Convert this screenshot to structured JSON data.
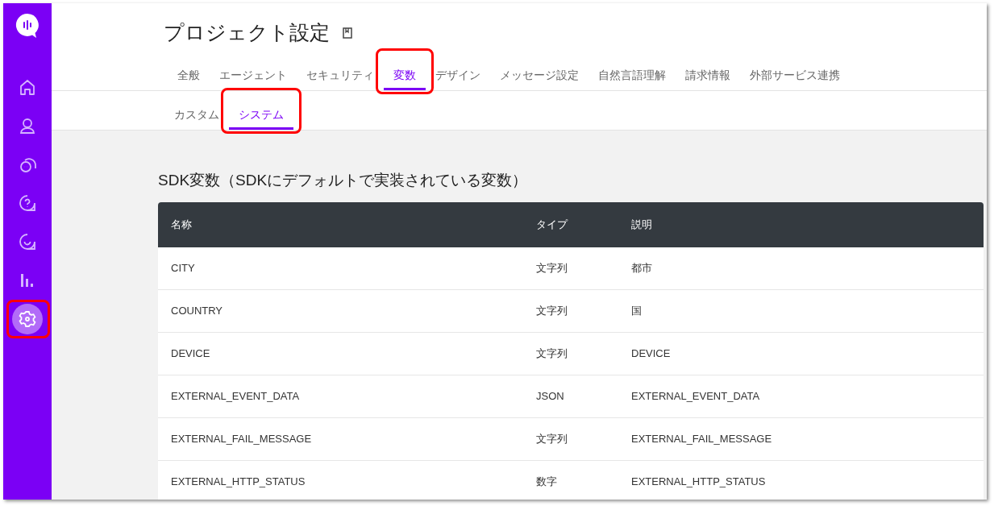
{
  "sidebar": {
    "items": [
      {
        "kind": "home",
        "selected": false,
        "annotated": false
      },
      {
        "kind": "person",
        "selected": false,
        "annotated": false
      },
      {
        "kind": "chat",
        "selected": false,
        "annotated": false
      },
      {
        "kind": "help",
        "selected": false,
        "annotated": false
      },
      {
        "kind": "smile",
        "selected": false,
        "annotated": false
      },
      {
        "kind": "chart",
        "selected": false,
        "annotated": false
      },
      {
        "kind": "settings",
        "selected": true,
        "annotated": true
      }
    ]
  },
  "page_title": "プロジェクト設定",
  "tabs": [
    {
      "label": "全般",
      "selected": false,
      "annotated": false
    },
    {
      "label": "エージェント",
      "selected": false,
      "annotated": false
    },
    {
      "label": "セキュリティ",
      "selected": false,
      "annotated": false
    },
    {
      "label": "変数",
      "selected": true,
      "annotated": true
    },
    {
      "label": "デザイン",
      "selected": false,
      "annotated": false
    },
    {
      "label": "メッセージ設定",
      "selected": false,
      "annotated": false
    },
    {
      "label": "自然言語理解",
      "selected": false,
      "annotated": false
    },
    {
      "label": "請求情報",
      "selected": false,
      "annotated": false
    },
    {
      "label": "外部サービス連携",
      "selected": false,
      "annotated": false
    }
  ],
  "subtabs": [
    {
      "label": "カスタム",
      "selected": false,
      "annotated": false
    },
    {
      "label": "システム",
      "selected": true,
      "annotated": true
    }
  ],
  "section_title": "SDK変数（SDKにデフォルトで実装されている変数）",
  "table": {
    "columns": [
      "名称",
      "タイプ",
      "説明"
    ],
    "rows": [
      [
        "CITY",
        "文字列",
        "都市"
      ],
      [
        "COUNTRY",
        "文字列",
        "国"
      ],
      [
        "DEVICE",
        "文字列",
        "DEVICE"
      ],
      [
        "EXTERNAL_EVENT_DATA",
        "JSON",
        "EXTERNAL_EVENT_DATA"
      ],
      [
        "EXTERNAL_FAIL_MESSAGE",
        "文字列",
        "EXTERNAL_FAIL_MESSAGE"
      ],
      [
        "EXTERNAL_HTTP_STATUS",
        "数字",
        "EXTERNAL_HTTP_STATUS"
      ]
    ]
  }
}
